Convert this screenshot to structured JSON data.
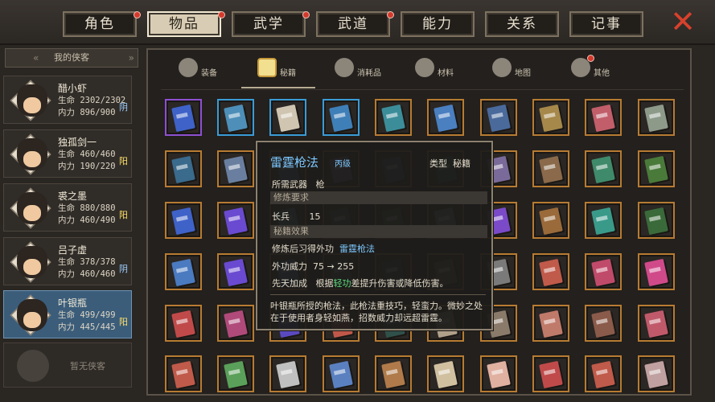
{
  "topbar": {
    "tabs": [
      {
        "label": "角色",
        "badge": true
      },
      {
        "label": "物品",
        "badge": true,
        "active": true
      },
      {
        "label": "武学",
        "badge": true
      },
      {
        "label": "武道",
        "badge": true
      },
      {
        "label": "能力",
        "badge": false
      },
      {
        "label": "关系",
        "badge": false
      },
      {
        "label": "记事",
        "badge": false
      }
    ],
    "close_icon": "close-x-icon"
  },
  "sidebar": {
    "title": "我的侠客",
    "heroes": [
      {
        "name": "醋小虾",
        "hp": "生命 2302/2302",
        "mp": "内力 896/900",
        "aff": "阴",
        "active": false
      },
      {
        "name": "独孤剑一",
        "hp": "生命 460/460",
        "mp": "内力 190/220",
        "aff": "阳",
        "active": false
      },
      {
        "name": "裘之墨",
        "hp": "生命 880/880",
        "mp": "内力 460/490",
        "aff": "阳",
        "active": false
      },
      {
        "name": "吕子虚",
        "hp": "生命 378/378",
        "mp": "内力 460/460",
        "aff": "阴",
        "active": false
      },
      {
        "name": "叶银瓶",
        "hp": "生命 499/499",
        "mp": "内力 445/445",
        "aff": "阳",
        "active": true
      }
    ],
    "empty_slot": "暂无侠客"
  },
  "subtabs": [
    {
      "label": "装备",
      "icon": "armor-icon"
    },
    {
      "label": "秘籍",
      "icon": "book-icon",
      "active": true
    },
    {
      "label": "消耗品",
      "icon": "potion-icon"
    },
    {
      "label": "材料",
      "icon": "material-icon"
    },
    {
      "label": "地图",
      "icon": "map-icon"
    },
    {
      "label": "其他",
      "icon": "misc-icon",
      "badge": true
    }
  ],
  "colors": {
    "orange_frame": "#b77b32",
    "purple_frame": "#8d4fd1",
    "blue_frame": "#3a9bd6"
  },
  "tooltip": {
    "title": "雷霆枪法",
    "rank": "丙级",
    "type_label": "类型",
    "type_value": "秘籍",
    "weapon_label": "所需武器",
    "weapon_value": "枪",
    "req_header": "修炼要求",
    "req_stat": "长兵",
    "req_value": "15",
    "effect_header": "秘籍效果",
    "learn_label": "修炼后习得外功",
    "learn_value": "雷霆枪法",
    "power_label": "外功威力",
    "power_value": "75 → 255",
    "bonus_label": "先天加成",
    "bonus_pre": "根据",
    "bonus_key": "轻功",
    "bonus_post": "差提升伤害或降低伤害。",
    "description": "叶银瓶所授的枪法，此枪法重技巧，轻蛮力。微妙之处在于使用者身轻如燕，招数威力却远超雷霆。"
  }
}
